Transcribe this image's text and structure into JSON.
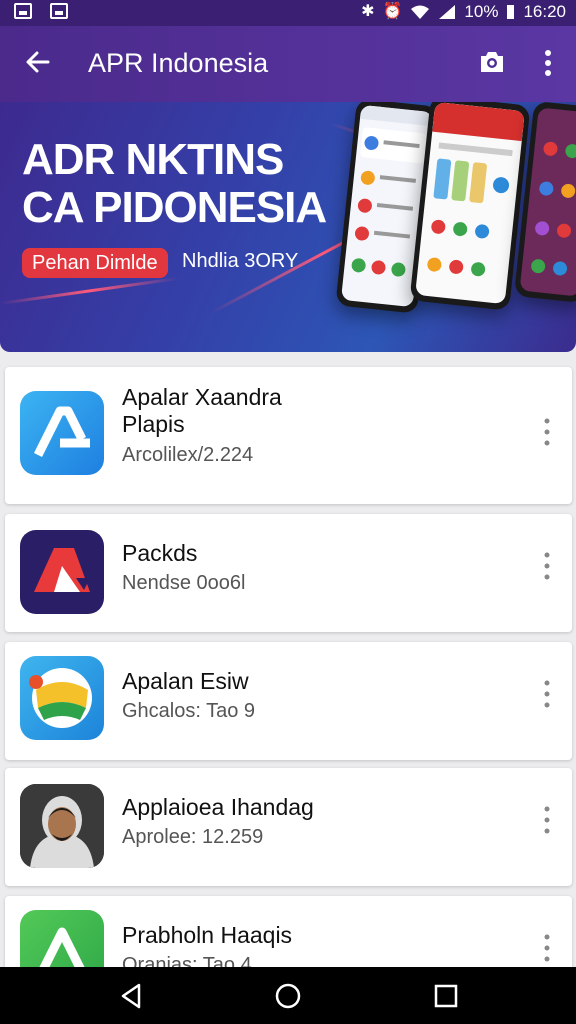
{
  "status": {
    "battery_text": "10%",
    "time": "16:20"
  },
  "appbar": {
    "title": "APR Indonesia"
  },
  "banner": {
    "headline_1": "ADR NKTINS",
    "headline_2": "CA PIDONESIA",
    "pill_text": "Pehan Dimlde",
    "sub_text": "Nhdlia 3ORY"
  },
  "apps": [
    {
      "name_1": "Apalar Xaandra",
      "name_2": "Plapis",
      "meta": "Arcolilex/2.224"
    },
    {
      "name_1": "Packds",
      "meta": "Nendse 0oo6l"
    },
    {
      "name_1": "Apalan Esiw",
      "meta": "Ghcalos: Tao 9"
    },
    {
      "name_1": "Applaioea Ihandag",
      "meta": "Aprolee: 12.259"
    },
    {
      "name_1": "Prabholn Haaqis",
      "meta": "Oranias: Tao 4"
    }
  ],
  "colors": {
    "appbar": "#4b2a8c",
    "banner": "#3440a8",
    "pill": "#e2373f"
  }
}
